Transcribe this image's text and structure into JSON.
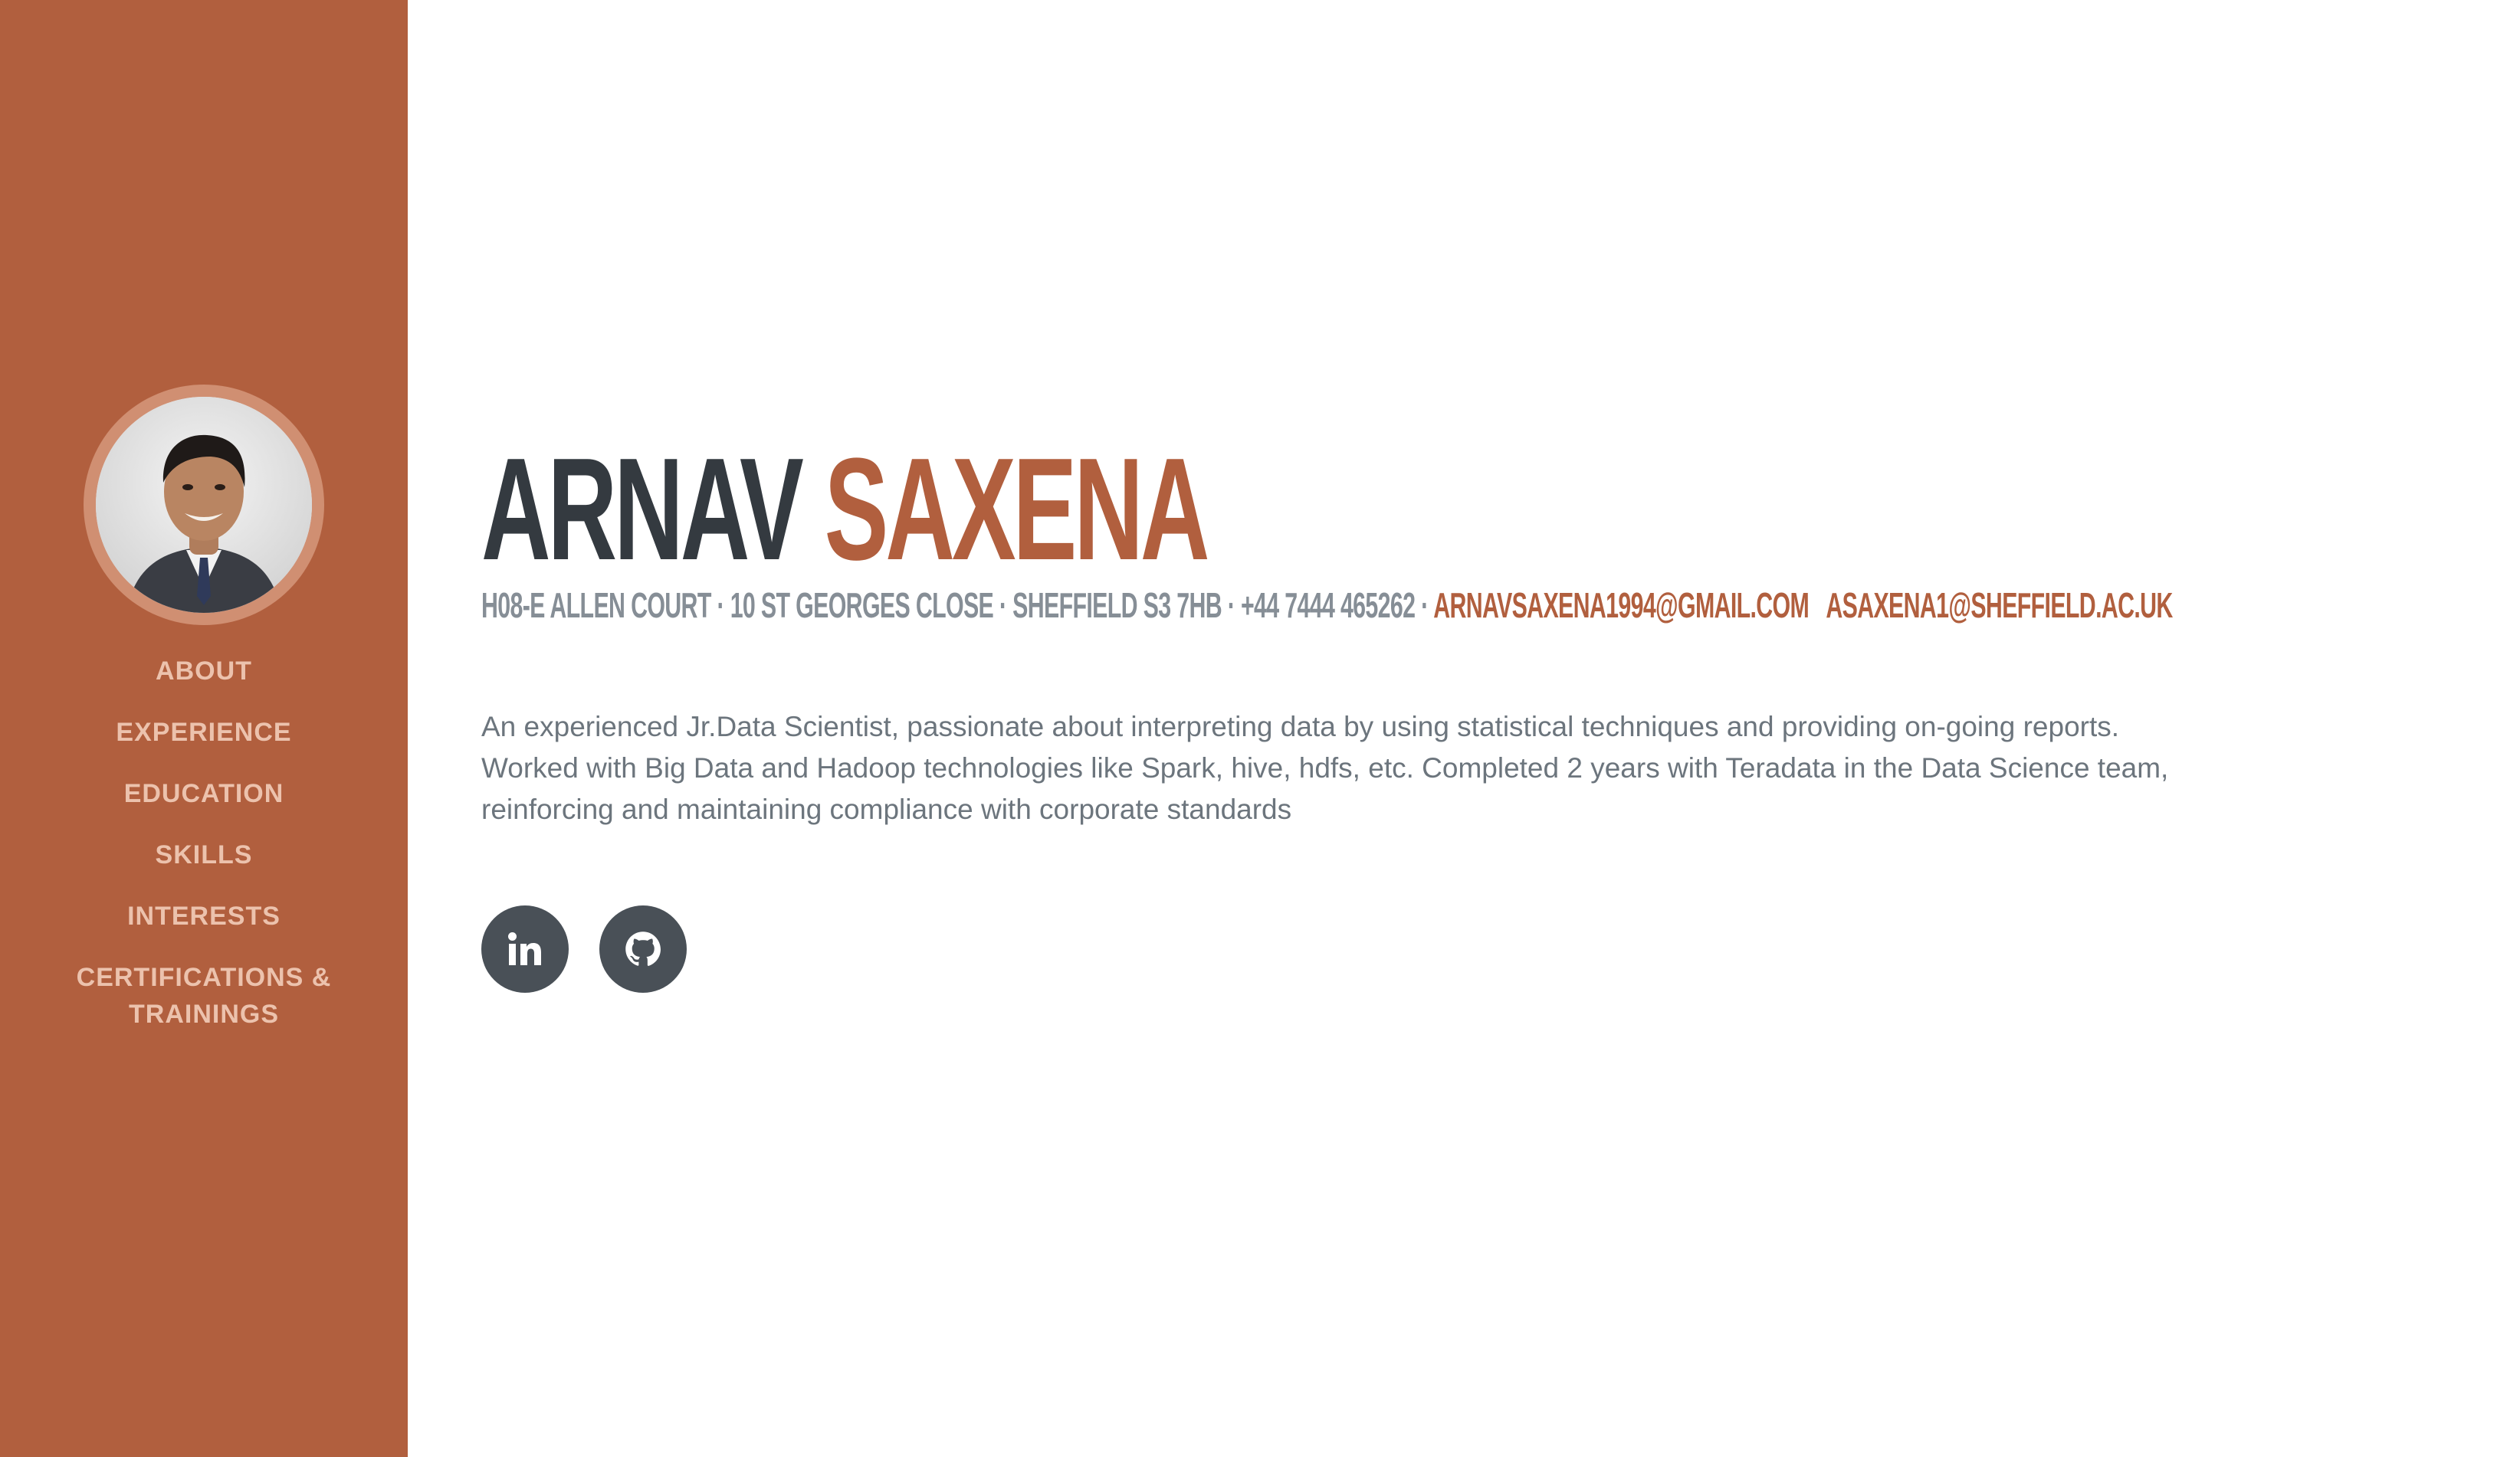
{
  "profile": {
    "first_name": "ARNAV",
    "last_name": "SAXENA",
    "address": "H08-E ALLEN COURT · 10 ST GEORGES CLOSE · SHEFFIELD S3 7HB ·",
    "phone": "+44 7444 465262 ·",
    "email_primary": "ARNAVSAXENA1994@GMAIL.COM",
    "email_secondary": "ASAXENA1@SHEFFIELD.AC.UK",
    "about": "An experienced Jr.Data Scientist, passionate about interpreting data by using statistical techniques and providing on-going reports. Worked with Big Data and Hadoop technologies like Spark, hive, hdfs, etc. Completed 2 years with Teradata in the Data Science team, reinforcing and maintaining compliance with corporate standards"
  },
  "nav": {
    "items": [
      {
        "label": "ABOUT"
      },
      {
        "label": "EXPERIENCE"
      },
      {
        "label": "EDUCATION"
      },
      {
        "label": "SKILLS"
      },
      {
        "label": "INTERESTS"
      },
      {
        "label": "CERTIFICATIONS & TRAININGS"
      }
    ]
  },
  "social": {
    "icons": [
      "linkedin-icon",
      "github-icon"
    ]
  },
  "colors": {
    "sidebar": "#b15f3e",
    "accent": "#b15f3e",
    "dark": "#343a40",
    "muted": "#868e96",
    "nav_text": "#ecc2ad",
    "social_bg": "#495057"
  }
}
